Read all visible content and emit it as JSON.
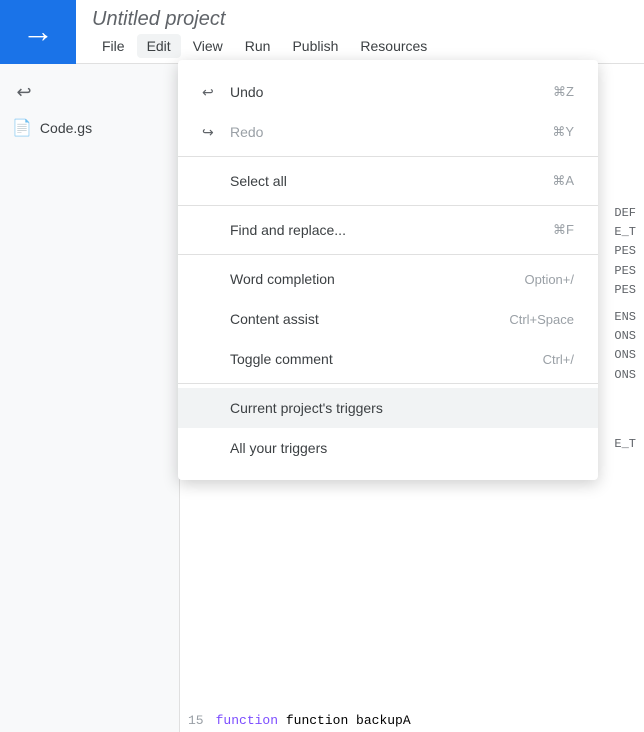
{
  "header": {
    "project_title": "Untitled project",
    "logo_arrow": "→"
  },
  "menubar": {
    "items": [
      {
        "id": "file",
        "label": "File"
      },
      {
        "id": "edit",
        "label": "Edit"
      },
      {
        "id": "view",
        "label": "View"
      },
      {
        "id": "run",
        "label": "Run"
      },
      {
        "id": "publish",
        "label": "Publish"
      },
      {
        "id": "resources",
        "label": "Resources"
      }
    ]
  },
  "sidebar": {
    "undo_label": "↩",
    "redo_label": "↪",
    "file": {
      "icon": "📄",
      "name": "Code.gs"
    }
  },
  "dropdown": {
    "sections": [
      {
        "items": [
          {
            "id": "undo",
            "icon": "↩",
            "label": "Undo",
            "shortcut": "⌘Z",
            "disabled": false
          },
          {
            "id": "redo",
            "icon": "↪",
            "label": "Redo",
            "shortcut": "⌘Y",
            "disabled": true
          }
        ]
      },
      {
        "items": [
          {
            "id": "select-all",
            "icon": "",
            "label": "Select all",
            "shortcut": "⌘A",
            "disabled": false
          }
        ]
      },
      {
        "items": [
          {
            "id": "find-replace",
            "icon": "",
            "label": "Find and replace...",
            "shortcut": "⌘F",
            "disabled": false
          }
        ]
      },
      {
        "items": [
          {
            "id": "word-completion",
            "icon": "",
            "label": "Word completion",
            "shortcut": "Option+/",
            "disabled": false
          },
          {
            "id": "content-assist",
            "icon": "",
            "label": "Content assist",
            "shortcut": "Ctrl+Space",
            "disabled": false
          },
          {
            "id": "toggle-comment",
            "icon": "",
            "label": "Toggle comment",
            "shortcut": "Ctrl+/",
            "disabled": false
          }
        ]
      },
      {
        "items": [
          {
            "id": "current-triggers",
            "icon": "",
            "label": "Current project's triggers",
            "shortcut": "",
            "disabled": false,
            "highlighted": true
          },
          {
            "id": "all-triggers",
            "icon": "",
            "label": "All your triggers",
            "shortcut": "",
            "disabled": false
          }
        ]
      }
    ]
  },
  "editor": {
    "line_number": "15",
    "function_text": "function backupA"
  }
}
